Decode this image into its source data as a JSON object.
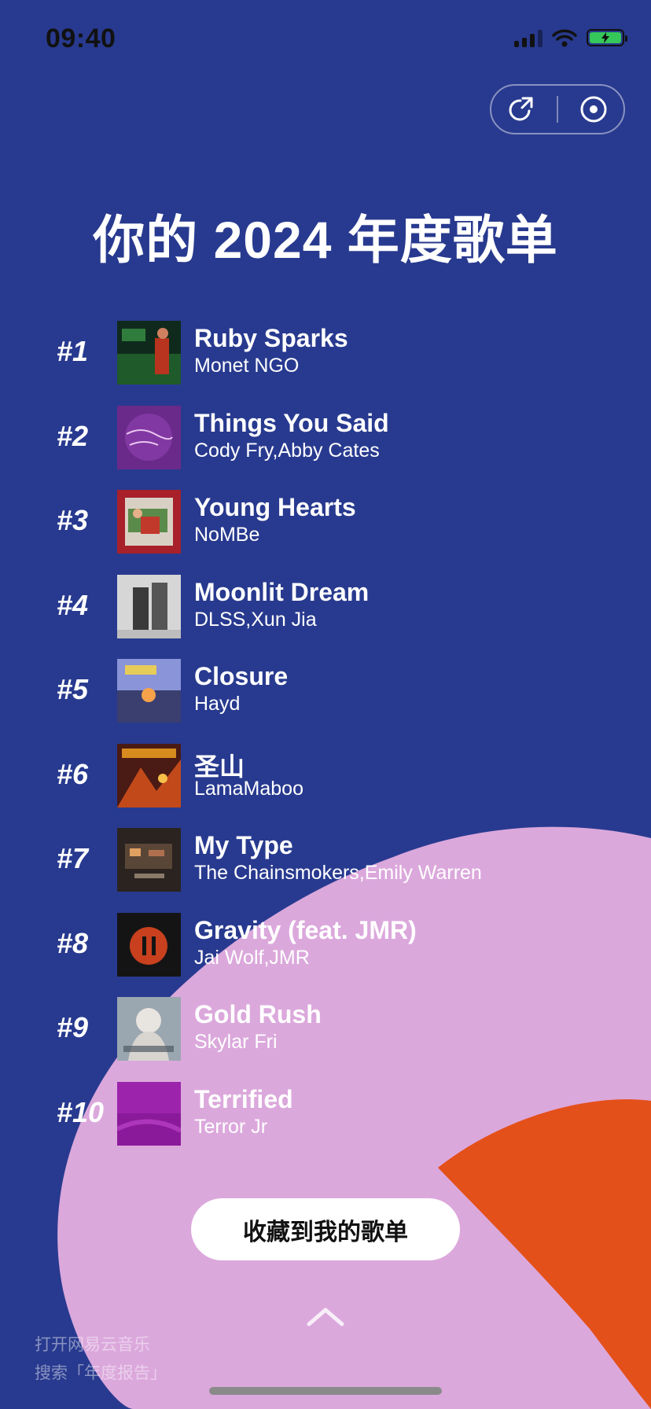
{
  "status_bar": {
    "time": "09:40"
  },
  "header": {
    "title": "你的 2024 年度歌单"
  },
  "songs": [
    {
      "rank": "#1",
      "title": "Ruby Sparks",
      "artist": "Monet NGO"
    },
    {
      "rank": "#2",
      "title": "Things You Said",
      "artist": "Cody Fry,Abby Cates"
    },
    {
      "rank": "#3",
      "title": "Young Hearts",
      "artist": "NoMBe"
    },
    {
      "rank": "#4",
      "title": "Moonlit Dream",
      "artist": "DLSS,Xun Jia"
    },
    {
      "rank": "#5",
      "title": "Closure",
      "artist": "Hayd"
    },
    {
      "rank": "#6",
      "title": "圣山",
      "artist": "LamaMaboo"
    },
    {
      "rank": "#7",
      "title": "My Type",
      "artist": "The Chainsmokers,Emily Warren"
    },
    {
      "rank": "#8",
      "title": "Gravity (feat. JMR)",
      "artist": "Jai Wolf,JMR"
    },
    {
      "rank": "#9",
      "title": "Gold Rush",
      "artist": "Skylar Fri"
    },
    {
      "rank": "#10",
      "title": "Terrified",
      "artist": "Terror Jr"
    }
  ],
  "actions": {
    "collect_label": "收藏到我的歌单"
  },
  "footer": {
    "watermark_line1": "打开网易云音乐",
    "watermark_line2": "搜索「年度报告」"
  },
  "icons": {
    "share": "share-icon",
    "record": "record-icon",
    "expand": "chevron-up-icon",
    "signal": "signal-icon",
    "wifi": "wifi-icon",
    "battery": "battery-charging-icon"
  },
  "colors": {
    "background": "#283a8f",
    "blob_pink": "#dba8dc",
    "blob_orange": "#e4501a",
    "text": "#ffffff",
    "button_bg": "#ffffff"
  }
}
